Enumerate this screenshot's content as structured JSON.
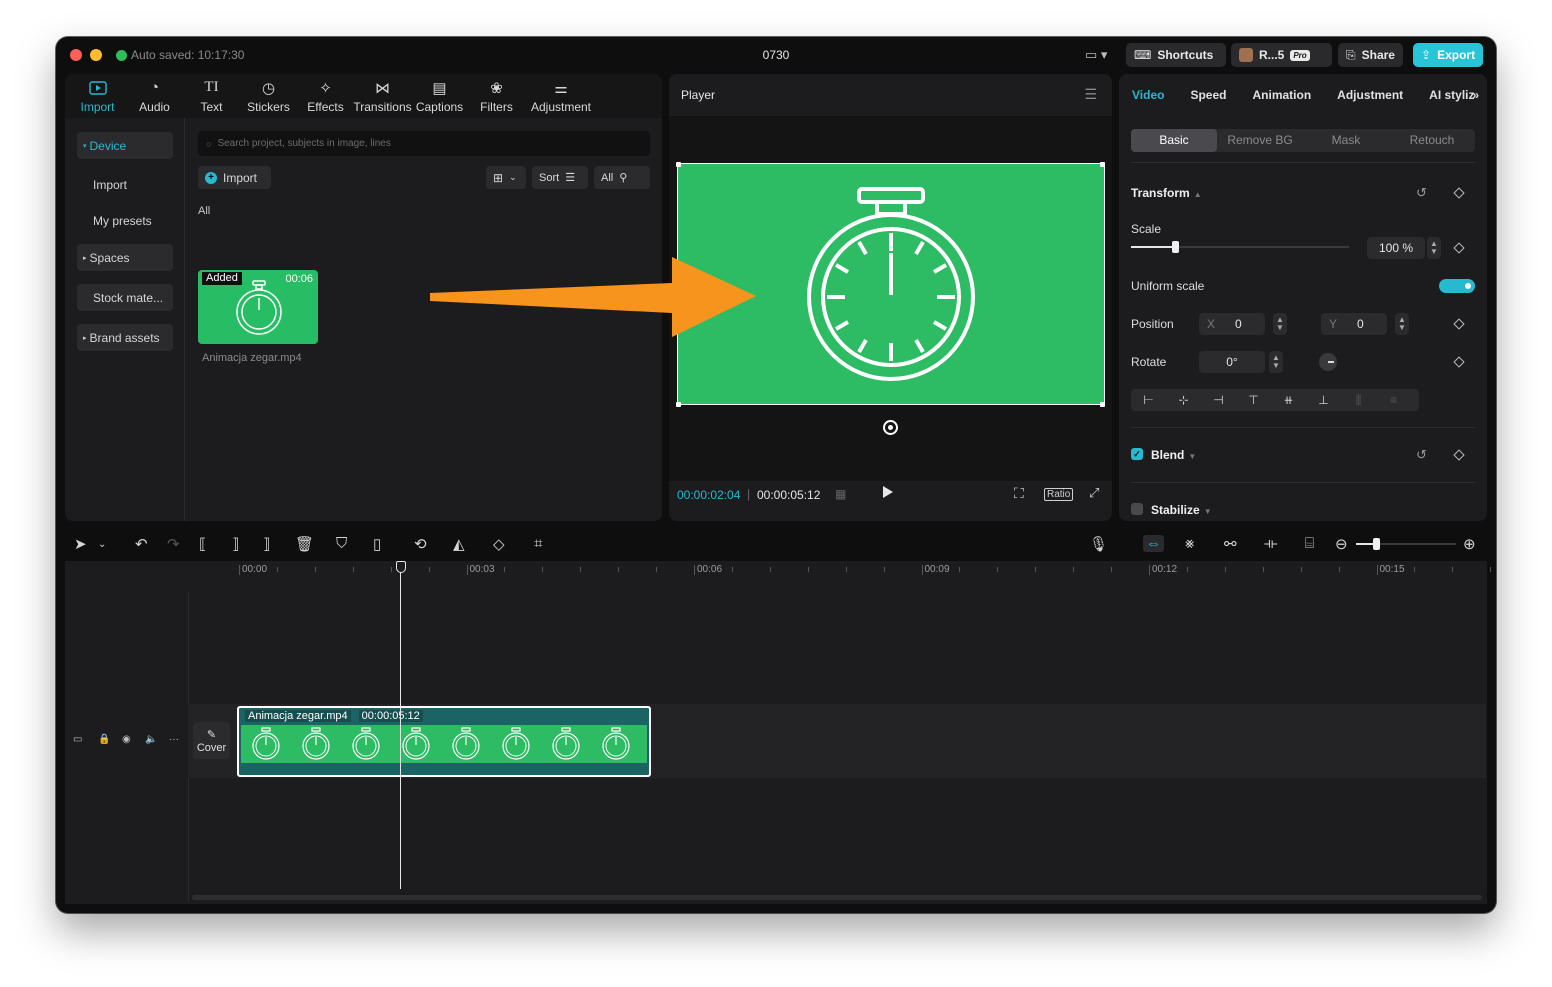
{
  "window": {
    "autosave": "Auto saved: 10:17:30",
    "title": "0730",
    "shortcuts_label": "Shortcuts",
    "user_label": "R...5",
    "pro_badge": "Pro",
    "share_label": "Share",
    "export_label": "Export"
  },
  "media_tabs": [
    {
      "label": "Import",
      "icon": "import-icon"
    },
    {
      "label": "Audio",
      "icon": "audio-icon"
    },
    {
      "label": "Text",
      "icon": "text-icon"
    },
    {
      "label": "Stickers",
      "icon": "stickers-icon"
    },
    {
      "label": "Effects",
      "icon": "effects-icon"
    },
    {
      "label": "Transitions",
      "icon": "transitions-icon"
    },
    {
      "label": "Captions",
      "icon": "captions-icon"
    },
    {
      "label": "Filters",
      "icon": "filters-icon"
    },
    {
      "label": "Adjustment",
      "icon": "adjustment-icon"
    }
  ],
  "sidenav": {
    "device": "Device",
    "import": "Import",
    "presets": "My presets",
    "spaces": "Spaces",
    "stock": "Stock mate...",
    "brand": "Brand assets"
  },
  "media": {
    "search_placeholder": "Search project, subjects in image, lines",
    "import_label": "Import",
    "sort_label": "Sort",
    "all_filter": "All",
    "all_heading": "All",
    "item": {
      "badge": "Added",
      "duration": "00:06",
      "name": "Animacja zegar.mp4"
    }
  },
  "player": {
    "title": "Player",
    "current_time": "00:00:02:04",
    "total_time": "00:00:05:12",
    "ratio_label": "Ratio"
  },
  "inspector": {
    "tabs": [
      "Video",
      "Speed",
      "Animation",
      "Adjustment",
      "AI stylize"
    ],
    "subtabs": [
      "Basic",
      "Remove BG",
      "Mask",
      "Retouch"
    ],
    "transform": "Transform",
    "scale_label": "Scale",
    "scale_value": "100 %",
    "scale_fraction": 0.2,
    "uniform_label": "Uniform scale",
    "position_label": "Position",
    "x_label": "X",
    "x_value": "0",
    "y_label": "Y",
    "y_value": "0",
    "rotate_label": "Rotate",
    "rotate_value": "0°",
    "blend_label": "Blend",
    "stabilize_label": "Stabilize"
  },
  "timeline": {
    "ticks": [
      "00:00",
      "00:03",
      "00:06",
      "00:09",
      "00:12",
      "00:15"
    ],
    "clip_name": "Animacja zegar.mp4",
    "clip_duration": "00:00:05:12",
    "cover_label": "Cover"
  },
  "colors": {
    "accent": "#27b9d0",
    "green": "#2dbb63",
    "arrow": "#f7941d"
  }
}
